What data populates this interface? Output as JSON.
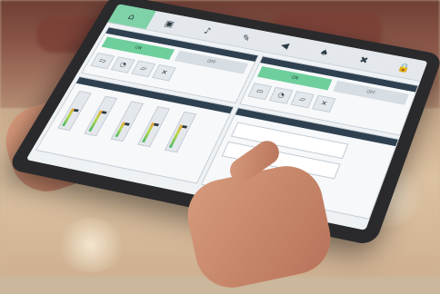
{
  "scene": {
    "description_free": true
  },
  "tablet": {
    "tabs": [
      {
        "icon": "⌂",
        "label": "",
        "active": true
      },
      {
        "icon": "▣",
        "label": "",
        "active": false
      },
      {
        "icon": "♪",
        "label": "",
        "active": false
      },
      {
        "icon": "✎",
        "label": "",
        "active": false
      },
      {
        "icon": "◀",
        "label": "",
        "active": false
      },
      {
        "icon": "♠",
        "label": "",
        "active": false
      },
      {
        "icon": "✖",
        "label": "",
        "active": false
      },
      {
        "icon": "🔒",
        "label": "",
        "active": false
      }
    ],
    "left_panel": {
      "title": "",
      "on_label": "ON",
      "off_label": "OFF",
      "mini_buttons": [
        "",
        "",
        "",
        ""
      ]
    },
    "right_panel": {
      "title": "",
      "on_label": "ON",
      "off_label": "OFF",
      "mini_buttons": [
        "",
        "",
        "",
        ""
      ]
    },
    "mixer_panel": {
      "title": "",
      "faders": [
        0.55,
        0.65,
        0.45,
        0.6,
        0.7
      ]
    }
  },
  "colors": {
    "accent_green": "#6ecf9c",
    "panel_dark": "#2f4150",
    "bezel": "#2a2a2c"
  }
}
